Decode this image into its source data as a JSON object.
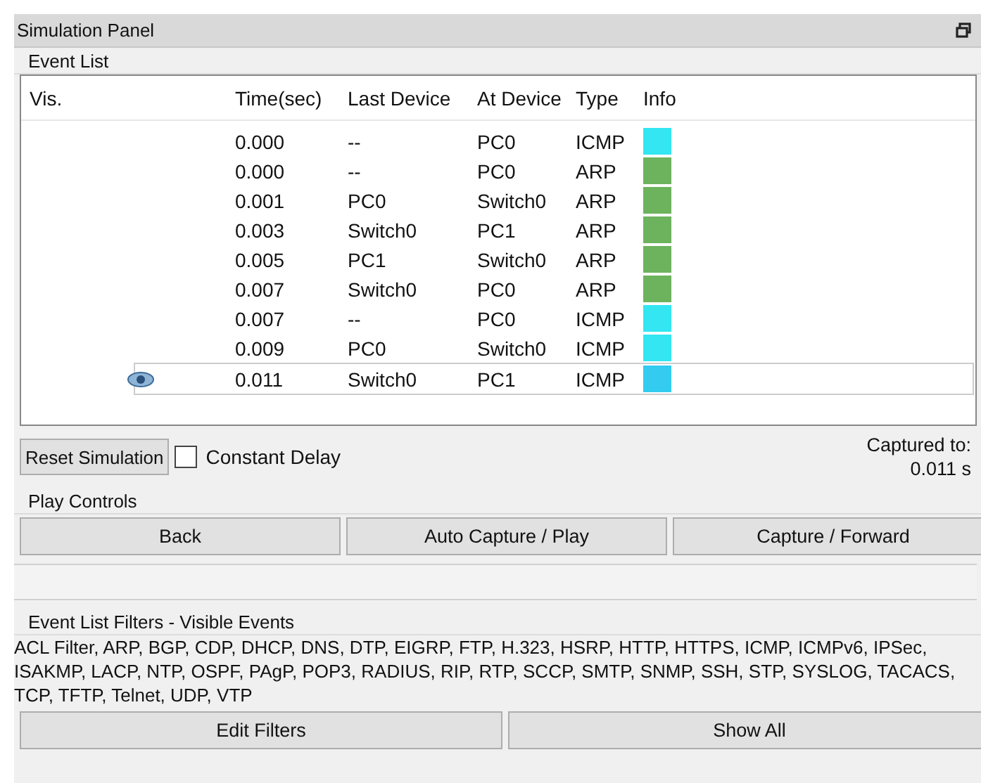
{
  "window": {
    "title": "Simulation Panel"
  },
  "event_list": {
    "title": "Event List",
    "columns": [
      "Vis.",
      "Time(sec)",
      "Last Device",
      "At Device",
      "Type",
      "Info"
    ],
    "rows": [
      {
        "visible": false,
        "time": "0.000",
        "last_device": "--",
        "at_device": "PC0",
        "type": "ICMP",
        "color": "#33e6f2",
        "selected": false
      },
      {
        "visible": false,
        "time": "0.000",
        "last_device": "--",
        "at_device": "PC0",
        "type": "ARP",
        "color": "#6db35d",
        "selected": false
      },
      {
        "visible": false,
        "time": "0.001",
        "last_device": "PC0",
        "at_device": "Switch0",
        "type": "ARP",
        "color": "#6db35d",
        "selected": false
      },
      {
        "visible": false,
        "time": "0.003",
        "last_device": "Switch0",
        "at_device": "PC1",
        "type": "ARP",
        "color": "#6db35d",
        "selected": false
      },
      {
        "visible": false,
        "time": "0.005",
        "last_device": "PC1",
        "at_device": "Switch0",
        "type": "ARP",
        "color": "#6db35d",
        "selected": false
      },
      {
        "visible": false,
        "time": "0.007",
        "last_device": "Switch0",
        "at_device": "PC0",
        "type": "ARP",
        "color": "#6db35d",
        "selected": false
      },
      {
        "visible": false,
        "time": "0.007",
        "last_device": "--",
        "at_device": "PC0",
        "type": "ICMP",
        "color": "#33e6f2",
        "selected": false
      },
      {
        "visible": false,
        "time": "0.009",
        "last_device": "PC0",
        "at_device": "Switch0",
        "type": "ICMP",
        "color": "#33e6f2",
        "selected": false
      },
      {
        "visible": true,
        "time": "0.011",
        "last_device": "Switch0",
        "at_device": "PC1",
        "type": "ICMP",
        "color": "#33ccf0",
        "selected": true
      }
    ]
  },
  "reset_button": "Reset Simulation",
  "constant_delay": {
    "label": "Constant Delay",
    "checked": false
  },
  "captured": {
    "label": "Captured to:",
    "value": "0.011 s"
  },
  "play_controls": {
    "title": "Play Controls",
    "buttons": [
      "Back",
      "Auto Capture / Play",
      "Capture / Forward"
    ]
  },
  "filters": {
    "title": "Event List Filters - Visible Events",
    "text": "ACL Filter, ARP, BGP, CDP, DHCP, DNS, DTP, EIGRP, FTP, H.323, HSRP, HTTP, HTTPS, ICMP, ICMPv6, IPSec, ISAKMP, LACP, NTP, OSPF, PAgP, POP3, RADIUS, RIP, RTP, SCCP, SMTP, SNMP, SSH, STP, SYSLOG, TACACS, TCP, TFTP, Telnet, UDP, VTP",
    "buttons": [
      "Edit Filters",
      "Show All"
    ]
  }
}
